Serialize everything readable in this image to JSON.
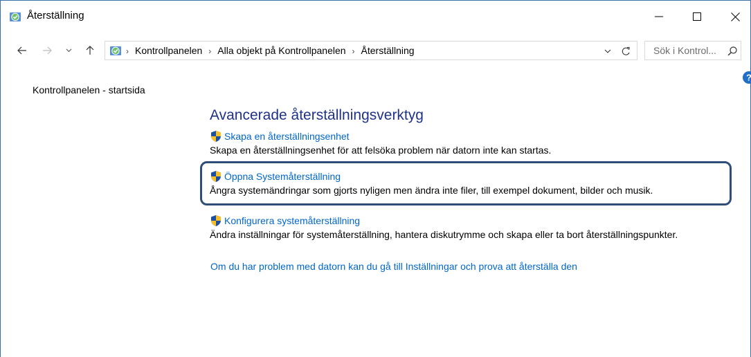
{
  "window": {
    "title": "Återställning"
  },
  "nav": {
    "breadcrumbs": [
      "Kontrollpanelen",
      "Alla objekt på Kontrollpanelen",
      "Återställning"
    ],
    "search_placeholder": "Sök i Kontrol..."
  },
  "sidebar": {
    "home_link": "Kontrollpanelen - startsida"
  },
  "main": {
    "heading": "Avancerade återställningsverktyg",
    "tasks": [
      {
        "label": "Skapa en återställningsenhet",
        "description": "Skapa en återställningsenhet för att felsöka problem när datorn inte kan startas.",
        "icon": "uac-shield-icon"
      },
      {
        "label": "Öppna Systemåterställning",
        "description": "Ångra systemändringar som gjorts nyligen men ändra inte filer, till exempel dokument, bilder och musik.",
        "icon": "uac-shield-icon"
      },
      {
        "label": "Konfigurera systemåterställning",
        "description": "Ändra inställningar för systemåterställning, hantera diskutrymme och skapa eller ta bort återställningspunkter.",
        "icon": "uac-shield-icon"
      }
    ],
    "trouble_link": "Om du har problem med datorn kan du gå till Inställningar och prova att återställa den"
  },
  "colors": {
    "link": "#0066cc",
    "heading": "#1e3287",
    "highlight_border": "#2d4e79",
    "window_border": "#3b6fa8"
  }
}
